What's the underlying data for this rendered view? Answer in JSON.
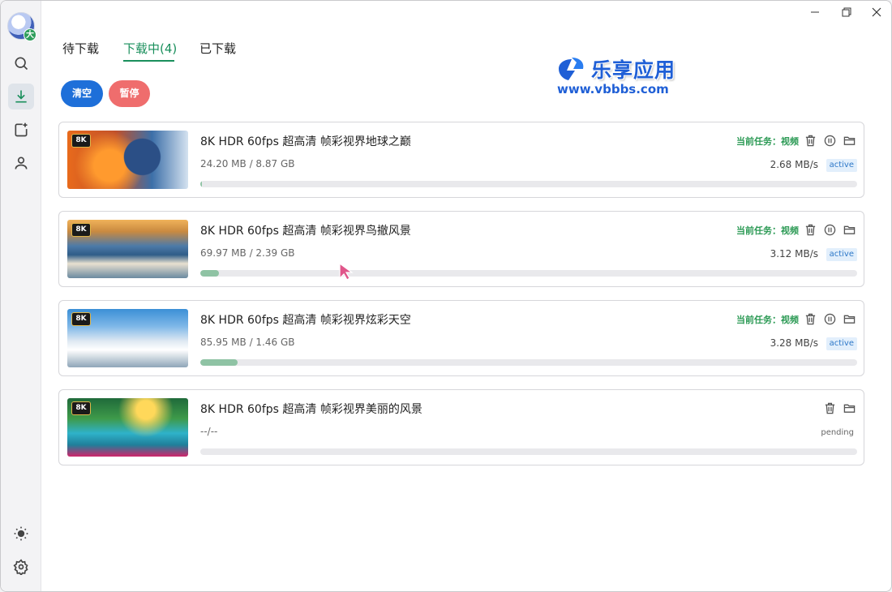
{
  "avatar": {
    "badge": "大"
  },
  "tabs": [
    {
      "label": "待下载",
      "active": false
    },
    {
      "label": "下载中(4)",
      "active": true
    },
    {
      "label": "已下载",
      "active": false
    }
  ],
  "logo": {
    "title": "乐享应用",
    "url": "www.vbbbs.com"
  },
  "actions": {
    "clear_label": "清空",
    "pause_label": "暂停"
  },
  "colors": {
    "accent": "#1a8f5c",
    "clear_button": "#1e6fd9",
    "pause_button": "#ef6d6d",
    "progress": "#8fc3a4",
    "active_badge_bg": "#e2effc",
    "active_badge_text": "#2e78c8"
  },
  "sidebar": {
    "items": [
      {
        "icon": "search-icon"
      },
      {
        "icon": "download-icon",
        "active": true
      },
      {
        "icon": "add-task-icon"
      },
      {
        "icon": "user-icon"
      }
    ],
    "bottom": [
      {
        "icon": "theme-sun-icon"
      },
      {
        "icon": "settings-gear-icon"
      }
    ]
  },
  "downloads": [
    {
      "title": "8K HDR 60fps 超高清 帧彩视界地球之巅",
      "size": "24.20 MB / 8.87 GB",
      "progress": 0.3,
      "task_label": "当前任务：视频",
      "speed": "2.68 MB/s",
      "status": "active",
      "badge": "8K"
    },
    {
      "title": "8K HDR 60fps 超高清 帧彩视界鸟撤风景",
      "size": "69.97 MB / 2.39 GB",
      "progress": 2.9,
      "task_label": "当前任务：视频",
      "speed": "3.12 MB/s",
      "status": "active",
      "badge": "8K"
    },
    {
      "title": "8K HDR 60fps 超高清 帧彩视界炫彩天空",
      "size": "85.95 MB / 1.46 GB",
      "progress": 5.7,
      "task_label": "当前任务：视频",
      "speed": "3.28 MB/s",
      "status": "active",
      "badge": "8K"
    },
    {
      "title": "8K HDR 60fps 超高清 帧彩视界美丽的风景",
      "size": "--/--",
      "progress": 0,
      "task_label": "",
      "speed": "",
      "status": "pending",
      "badge": "8K"
    }
  ]
}
